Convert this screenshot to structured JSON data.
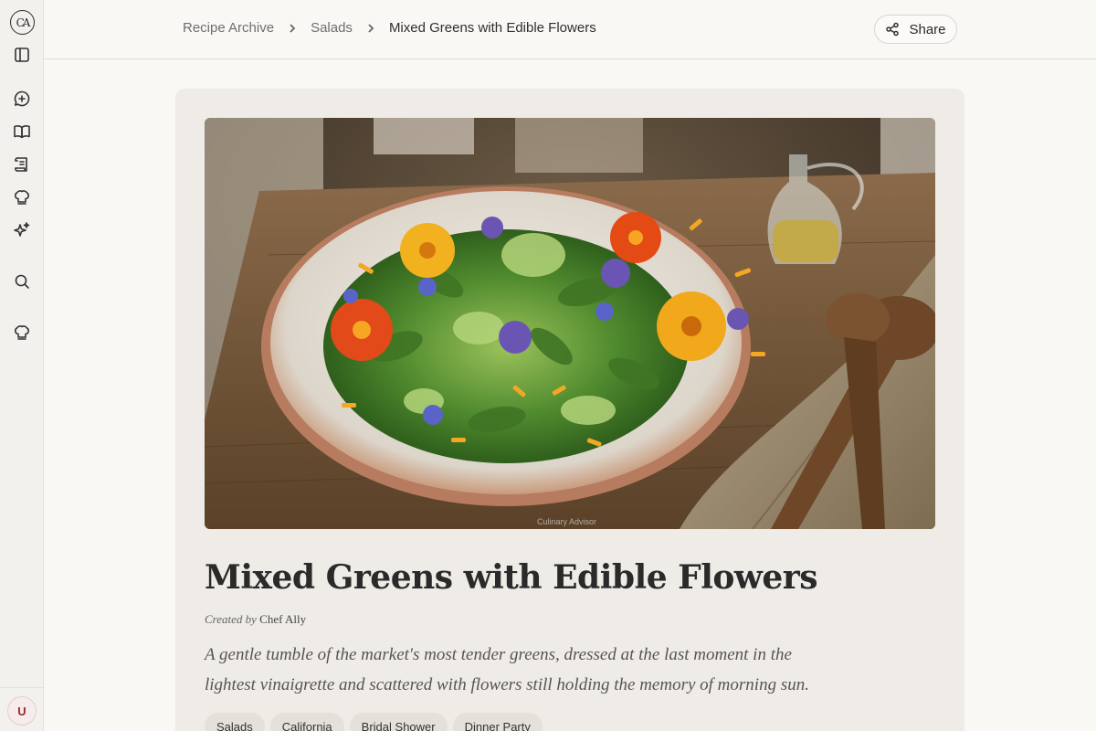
{
  "app": {
    "logo_text": "CA",
    "avatar_initial": "U"
  },
  "sidebar": {
    "icons": [
      "sidebar-toggle-icon",
      "new-chat-icon",
      "recipe-book-icon",
      "scroll-icon",
      "chef-hat-icon",
      "sparkles-icon",
      "search-icon",
      "chef-hat-icon"
    ]
  },
  "breadcrumb": {
    "items": [
      "Recipe Archive",
      "Salads",
      "Mixed Greens with Edible Flowers"
    ]
  },
  "header": {
    "share_label": "Share"
  },
  "recipe": {
    "image_watermark": "Culinary Advisor",
    "title": "Mixed Greens with Edible Flowers",
    "created_by_label": "Created by",
    "author": "Chef Ally",
    "description": "A gentle tumble of the market's most tender greens, dressed at the last moment in the lightest vinaigrette and scattered with flowers still holding the memory of morning sun.",
    "tags": [
      "Salads",
      "California",
      "Bridal Shower",
      "Dinner Party"
    ]
  },
  "colors": {
    "background": "#f9f8f5",
    "sidebar": "#f2f1ed",
    "card": "#efebe6",
    "tag": "#e4e0da",
    "avatar_text": "#9b2a2a"
  }
}
